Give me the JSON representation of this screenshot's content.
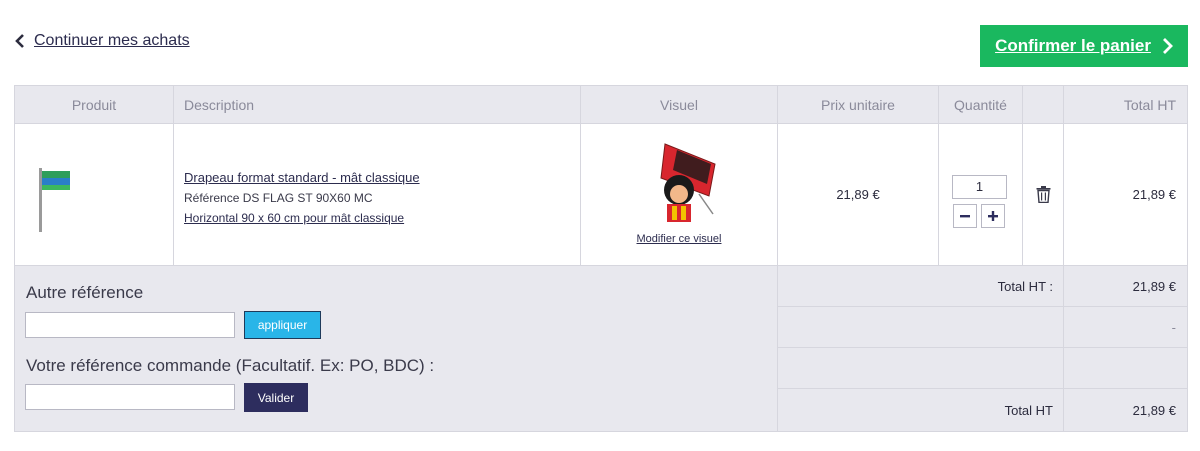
{
  "nav": {
    "continue_label": "Continuer mes achats",
    "confirm_label": "Confirmer le panier"
  },
  "table": {
    "headers": [
      "Produit",
      "Description",
      "Visuel",
      "Prix unitaire",
      "Quantité",
      "",
      "Total HT"
    ]
  },
  "item": {
    "title": "Drapeau format standard - mât classique",
    "reference": "Référence DS FLAG ST 90X60 MC",
    "dimensions": "Horizontal 90 x 60 cm pour mât classique",
    "modify_label": "Modifier ce visuel",
    "unit_price": "21,89 €",
    "quantity": "1",
    "total": "21,89 €"
  },
  "forms": {
    "other_ref_label": "Autre référence",
    "apply_label": "appliquer",
    "order_ref_label": "Votre référence commande (Facultatif. Ex: PO, BDC) :",
    "validate_label": "Valider"
  },
  "summary": {
    "rows": [
      {
        "label": "Total HT :",
        "value": "21,89 €"
      },
      {
        "label": "",
        "value": "-"
      },
      {
        "label": "",
        "value": ""
      },
      {
        "label": "Total HT",
        "value": "21,89 €"
      }
    ]
  },
  "colors": {
    "confirm_green": "#1ab85f",
    "apply_blue": "#29b5e8",
    "validate_navy": "#2d2d5e",
    "table_bg": "#e8e8ee"
  }
}
